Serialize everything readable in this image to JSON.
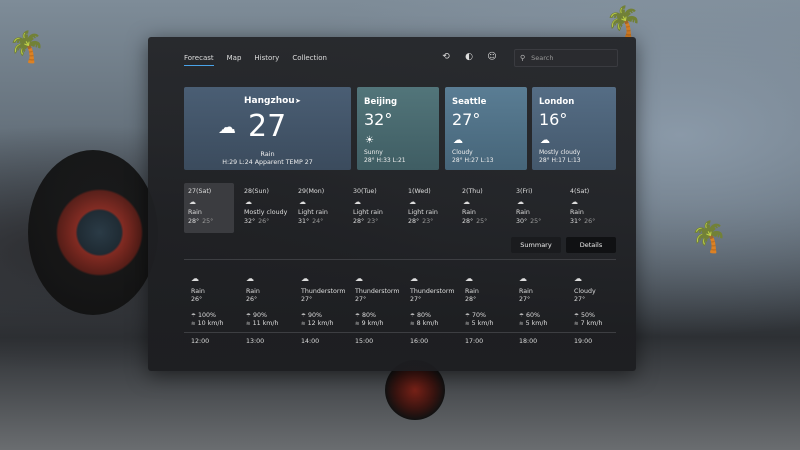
{
  "nav": {
    "tabs": [
      "Forecast",
      "Map",
      "History",
      "Collection"
    ],
    "active": "Forecast"
  },
  "toolbar": {
    "icons": [
      "refresh-icon",
      "theme-contrast-icon",
      "smile-icon"
    ]
  },
  "search": {
    "placeholder": "Search",
    "icon": "search-icon"
  },
  "main_card": {
    "city": "Hangzhou",
    "location_icon": "location-arrow-icon",
    "temp": "27",
    "condition": "Rain",
    "details": "H:29 L:24 Apparent TEMP 27",
    "icon": "rain-cloud-icon",
    "color": "#4a5e74"
  },
  "cities": [
    {
      "city": "Beijing",
      "temp": "32°",
      "condition": "Sunny",
      "hl": "28° H:33 L:21",
      "icon": "sun-icon",
      "color": "#52757a"
    },
    {
      "city": "Seattle",
      "temp": "27°",
      "condition": "Cloudy",
      "hl": "28° H:27 L:13",
      "icon": "cloud-icon",
      "color": "#5a7d94"
    },
    {
      "city": "London",
      "temp": "16°",
      "condition": "Mostly cloudy",
      "hl": "28° H:17 L:13",
      "icon": "cloud-icon",
      "color": "#556d85"
    }
  ],
  "days": [
    {
      "label": "27(Sat)",
      "condition": "Rain",
      "high": "28°",
      "low": "25°",
      "icon": "rain-cloud-icon"
    },
    {
      "label": "28(Sun)",
      "condition": "Mostly cloudy",
      "high": "32°",
      "low": "26°",
      "icon": "cloud-icon"
    },
    {
      "label": "29(Mon)",
      "condition": "Light rain",
      "high": "31°",
      "low": "24°",
      "icon": "rain-cloud-icon"
    },
    {
      "label": "30(Tue)",
      "condition": "Light rain",
      "high": "28°",
      "low": "23°",
      "icon": "rain-cloud-icon"
    },
    {
      "label": "1(Wed)",
      "condition": "Light rain",
      "high": "28°",
      "low": "23°",
      "icon": "rain-cloud-icon"
    },
    {
      "label": "2(Thu)",
      "condition": "Rain",
      "high": "28°",
      "low": "25°",
      "icon": "rain-cloud-icon"
    },
    {
      "label": "3(Fri)",
      "condition": "Rain",
      "high": "30°",
      "low": "25°",
      "icon": "rain-cloud-icon"
    },
    {
      "label": "4(Sat)",
      "condition": "Rain",
      "high": "31°",
      "low": "26°",
      "icon": "rain-cloud-icon"
    }
  ],
  "buttons": {
    "summary": "Summary",
    "details": "Details"
  },
  "hours": [
    {
      "condition": "Rain",
      "temp": "26°",
      "precip": "100%",
      "wind": "10 km/h",
      "time": "12:00",
      "icon": "rain-cloud-icon"
    },
    {
      "condition": "Rain",
      "temp": "26°",
      "precip": "90%",
      "wind": "11 km/h",
      "time": "13:00",
      "icon": "rain-cloud-icon"
    },
    {
      "condition": "Thunderstorm",
      "temp": "27°",
      "precip": "90%",
      "wind": "12 km/h",
      "time": "14:00",
      "icon": "thunderstorm-icon"
    },
    {
      "condition": "Thunderstorm",
      "temp": "27°",
      "precip": "80%",
      "wind": "9 km/h",
      "time": "15:00",
      "icon": "thunderstorm-icon"
    },
    {
      "condition": "Thunderstorm",
      "temp": "27°",
      "precip": "80%",
      "wind": "8 km/h",
      "time": "16:00",
      "icon": "thunderstorm-icon"
    },
    {
      "condition": "Rain",
      "temp": "28°",
      "precip": "70%",
      "wind": "5 km/h",
      "time": "17:00",
      "icon": "rain-cloud-icon"
    },
    {
      "condition": "Rain",
      "temp": "27°",
      "precip": "60%",
      "wind": "5 km/h",
      "time": "18:00",
      "icon": "rain-cloud-icon"
    },
    {
      "condition": "Cloudy",
      "temp": "27°",
      "precip": "50%",
      "wind": "7 km/h",
      "time": "19:00",
      "icon": "cloud-icon"
    }
  ]
}
